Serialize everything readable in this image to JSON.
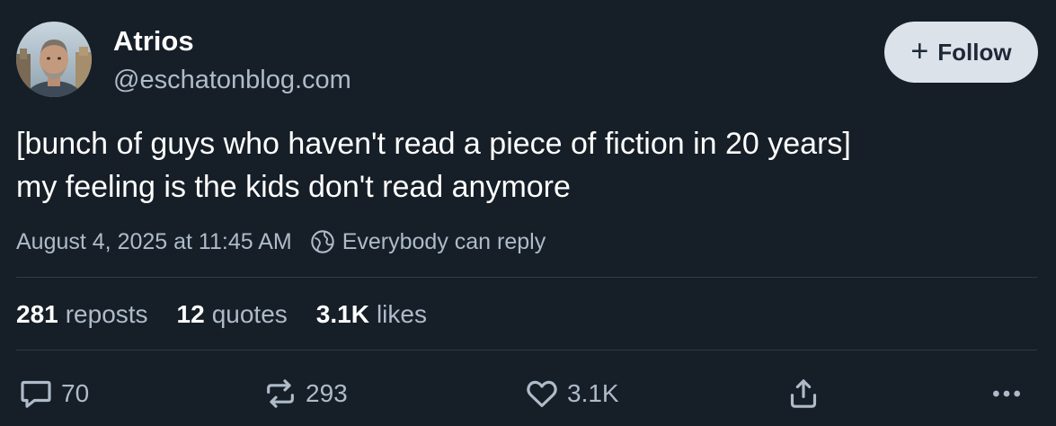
{
  "author": {
    "name": "Atrios",
    "handle": "@eschatonblog.com"
  },
  "follow_button": {
    "label": "Follow",
    "icon": "plus-icon"
  },
  "post": {
    "text_lines": [
      "[bunch of guys who haven't read a piece of fiction in 20 years]",
      "my feeling is the kids don't read anymore"
    ],
    "timestamp": "August 4, 2025 at 11:45 AM",
    "reply_setting": "Everybody can reply",
    "reply_setting_icon": "globe-icon"
  },
  "stats": {
    "reposts": {
      "count": "281",
      "label": "reposts"
    },
    "quotes": {
      "count": "12",
      "label": "quotes"
    },
    "likes": {
      "count": "3.1K",
      "label": "likes"
    }
  },
  "actions": {
    "reply": {
      "icon": "comment-icon",
      "count": "70"
    },
    "repost": {
      "icon": "repost-icon",
      "count": "293"
    },
    "like": {
      "icon": "heart-icon",
      "count": "3.1K"
    },
    "share": {
      "icon": "share-icon"
    },
    "more": {
      "icon": "more-icon"
    }
  },
  "colors": {
    "background": "#161e27",
    "text_primary": "#ffffff",
    "text_secondary": "#aebbc9",
    "divider": "#2e3a49",
    "follow_button_bg": "#dce2ea",
    "follow_button_text": "#1e2836"
  }
}
